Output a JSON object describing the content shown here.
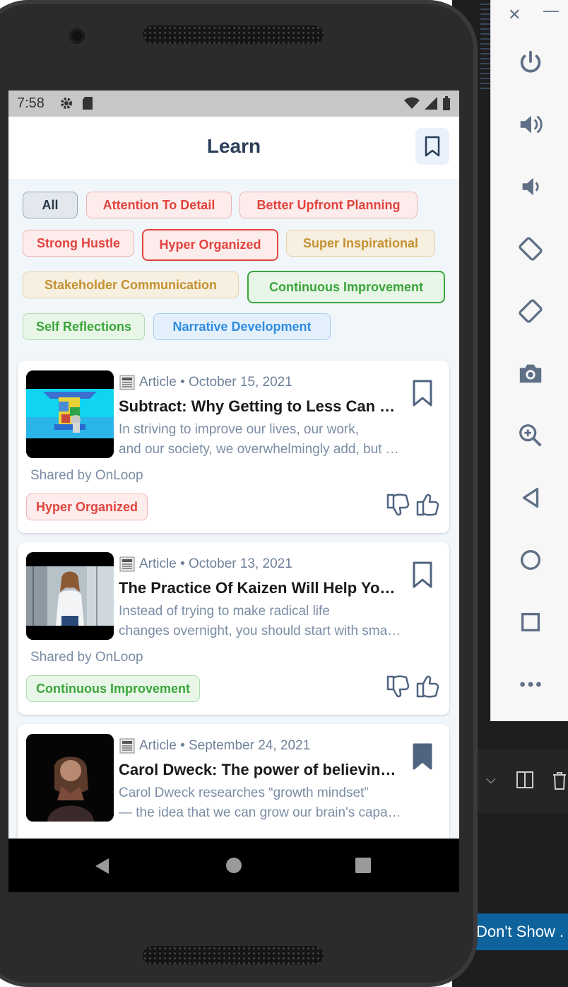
{
  "ide": {
    "dont_show_label": "Don't Show ."
  },
  "emulator_panel": {
    "close_glyph": "✕",
    "minimize_glyph": "—",
    "buttons": [
      "power-icon",
      "volume-up-icon",
      "volume-down-icon",
      "rotate-left-icon",
      "rotate-right-icon",
      "camera-icon",
      "zoom-icon",
      "back-icon",
      "home-icon",
      "overview-icon",
      "more-icon"
    ]
  },
  "status": {
    "time": "7:58"
  },
  "app": {
    "title": "Learn"
  },
  "filters": {
    "all": "All",
    "attention": "Attention To Detail",
    "planning": "Better Upfront Planning",
    "hustle": "Strong Hustle",
    "organized": "Hyper Organized",
    "inspirational": "Super Inspirational",
    "stakeholder": "Stakeholder Communication",
    "continuous": "Continuous Improvement",
    "reflections": "Self Reflections",
    "narrative": "Narrative Development"
  },
  "articles": [
    {
      "type": "Article",
      "date": "October 15, 2021",
      "meta": "Article • October 15, 2021",
      "title": "Subtract: Why Getting to Less Can Mean Thinking More",
      "desc_line1": "In striving to improve our lives, our work,",
      "desc_line2": "and our society, we overwhelmingly add, but subtracting",
      "shared": "Shared by OnLoop",
      "tag": "Hyper Organized",
      "bookmarked": false
    },
    {
      "type": "Article",
      "date": "October 13, 2021",
      "meta": "Article • October 13, 2021",
      "title": "The Practice Of Kaizen Will Help You Improve",
      "desc_line1": "Instead of trying to make radical life",
      "desc_line2": "changes overnight, you should start with small steps",
      "shared": "Shared by OnLoop",
      "tag": "Continuous Improvement",
      "bookmarked": false
    },
    {
      "type": "Article",
      "date": "September 24, 2021",
      "meta": "Article • September 24, 2021",
      "title": "Carol Dweck: The power of believing that you can improve",
      "desc_line1": "Carol Dweck researches “growth mindset”",
      "desc_line2": "— the idea that we can grow our brain's capacity",
      "bookmarked": true
    }
  ]
}
